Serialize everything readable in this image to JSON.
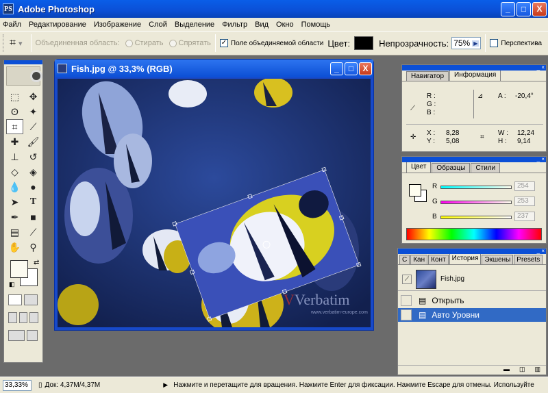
{
  "app": {
    "title": "Adobe Photoshop",
    "icon_letters": "PS"
  },
  "window_buttons": {
    "minimize": "_",
    "maximize": "□",
    "close": "X"
  },
  "menu": [
    "Файл",
    "Редактирование",
    "Изображение",
    "Слой",
    "Выделение",
    "Фильтр",
    "Вид",
    "Окно",
    "Помощь"
  ],
  "options": {
    "combined_area_label": "Объединенная область:",
    "erase_label": "Стирать",
    "hide_label": "Спрятать",
    "combined_field_label": "Поле объединяемой области",
    "color_label": "Цвет:",
    "opacity_label": "Непрозрачность:",
    "opacity_value": "75%",
    "perspective_label": "Перспектива",
    "combined_field_checked": true,
    "color_swatch": "#000000"
  },
  "document": {
    "title": "Fish.jpg @ 33,3% (RGB)",
    "watermark": "Verbatim",
    "watermark_url": "www.verbatim-europe.com"
  },
  "navigator": {
    "tabs": [
      "Навигатор",
      "Информация"
    ],
    "active_tab": "Информация",
    "r": "R :",
    "g": "G :",
    "b": "B :",
    "a_label": "A :",
    "a_value": "-20,4°",
    "x_label": "X :",
    "x_value": "8,28",
    "y_label": "Y :",
    "y_value": "5,08",
    "w_label": "W :",
    "w_value": "12,24",
    "h_label": "H :",
    "h_value": "9,14"
  },
  "color_panel": {
    "tabs": [
      "Цвет",
      "Образцы",
      "Стили"
    ],
    "r_label": "R",
    "r_value": "254",
    "g_label": "G",
    "g_value": "253",
    "b_label": "B",
    "b_value": "237"
  },
  "history": {
    "tabs": [
      "C",
      "Кан",
      "Конт",
      "История",
      "Экшены",
      "Presets"
    ],
    "snapshot": "Fish.jpg",
    "items": [
      "Открыть",
      "Авто Уровни"
    ],
    "selected": "Авто Уровни"
  },
  "status": {
    "zoom": "33,33%",
    "doc": "Док: 4,37M/4,37M",
    "hint": "Нажмите и перетащите для вращения. Нажмите Enter для фиксации. Нажмите Escape для отмены. Используйте Пробел для"
  },
  "colors": {
    "xp_blue": "#0b4fd6",
    "selection": "#316ac5",
    "panel": "#ece9d8"
  }
}
